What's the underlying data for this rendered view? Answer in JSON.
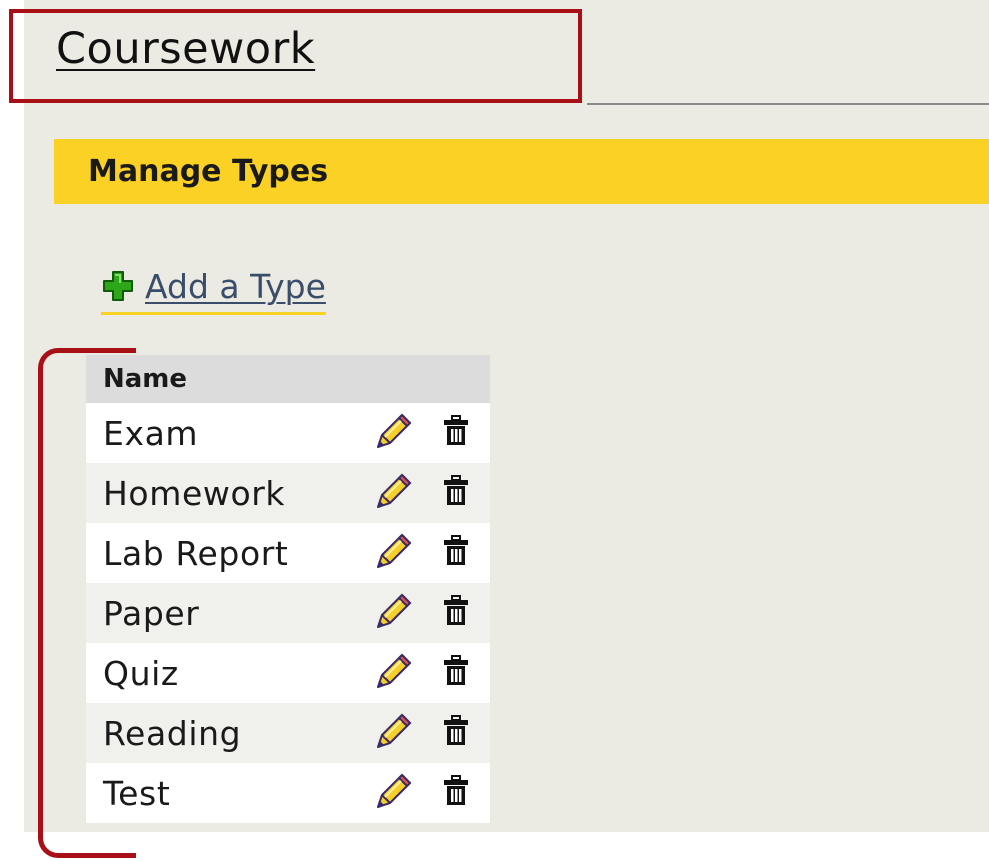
{
  "header": {
    "title": "Coursework"
  },
  "section": {
    "title": "Manage Types"
  },
  "actions": {
    "add_label": "Add a Type",
    "add_icon": "plus-icon"
  },
  "table": {
    "columns": [
      "Name"
    ],
    "rows": [
      {
        "name": "Exam"
      },
      {
        "name": "Homework"
      },
      {
        "name": "Lab Report"
      },
      {
        "name": "Paper"
      },
      {
        "name": "Quiz"
      },
      {
        "name": "Reading"
      },
      {
        "name": "Test"
      }
    ],
    "edit_icon": "pencil-icon",
    "delete_icon": "trash-icon"
  },
  "colors": {
    "accent_yellow": "#fcd125",
    "callout_red": "#a80f16",
    "plus_green": "#2ea619",
    "panel_bg": "#ebebe3"
  }
}
